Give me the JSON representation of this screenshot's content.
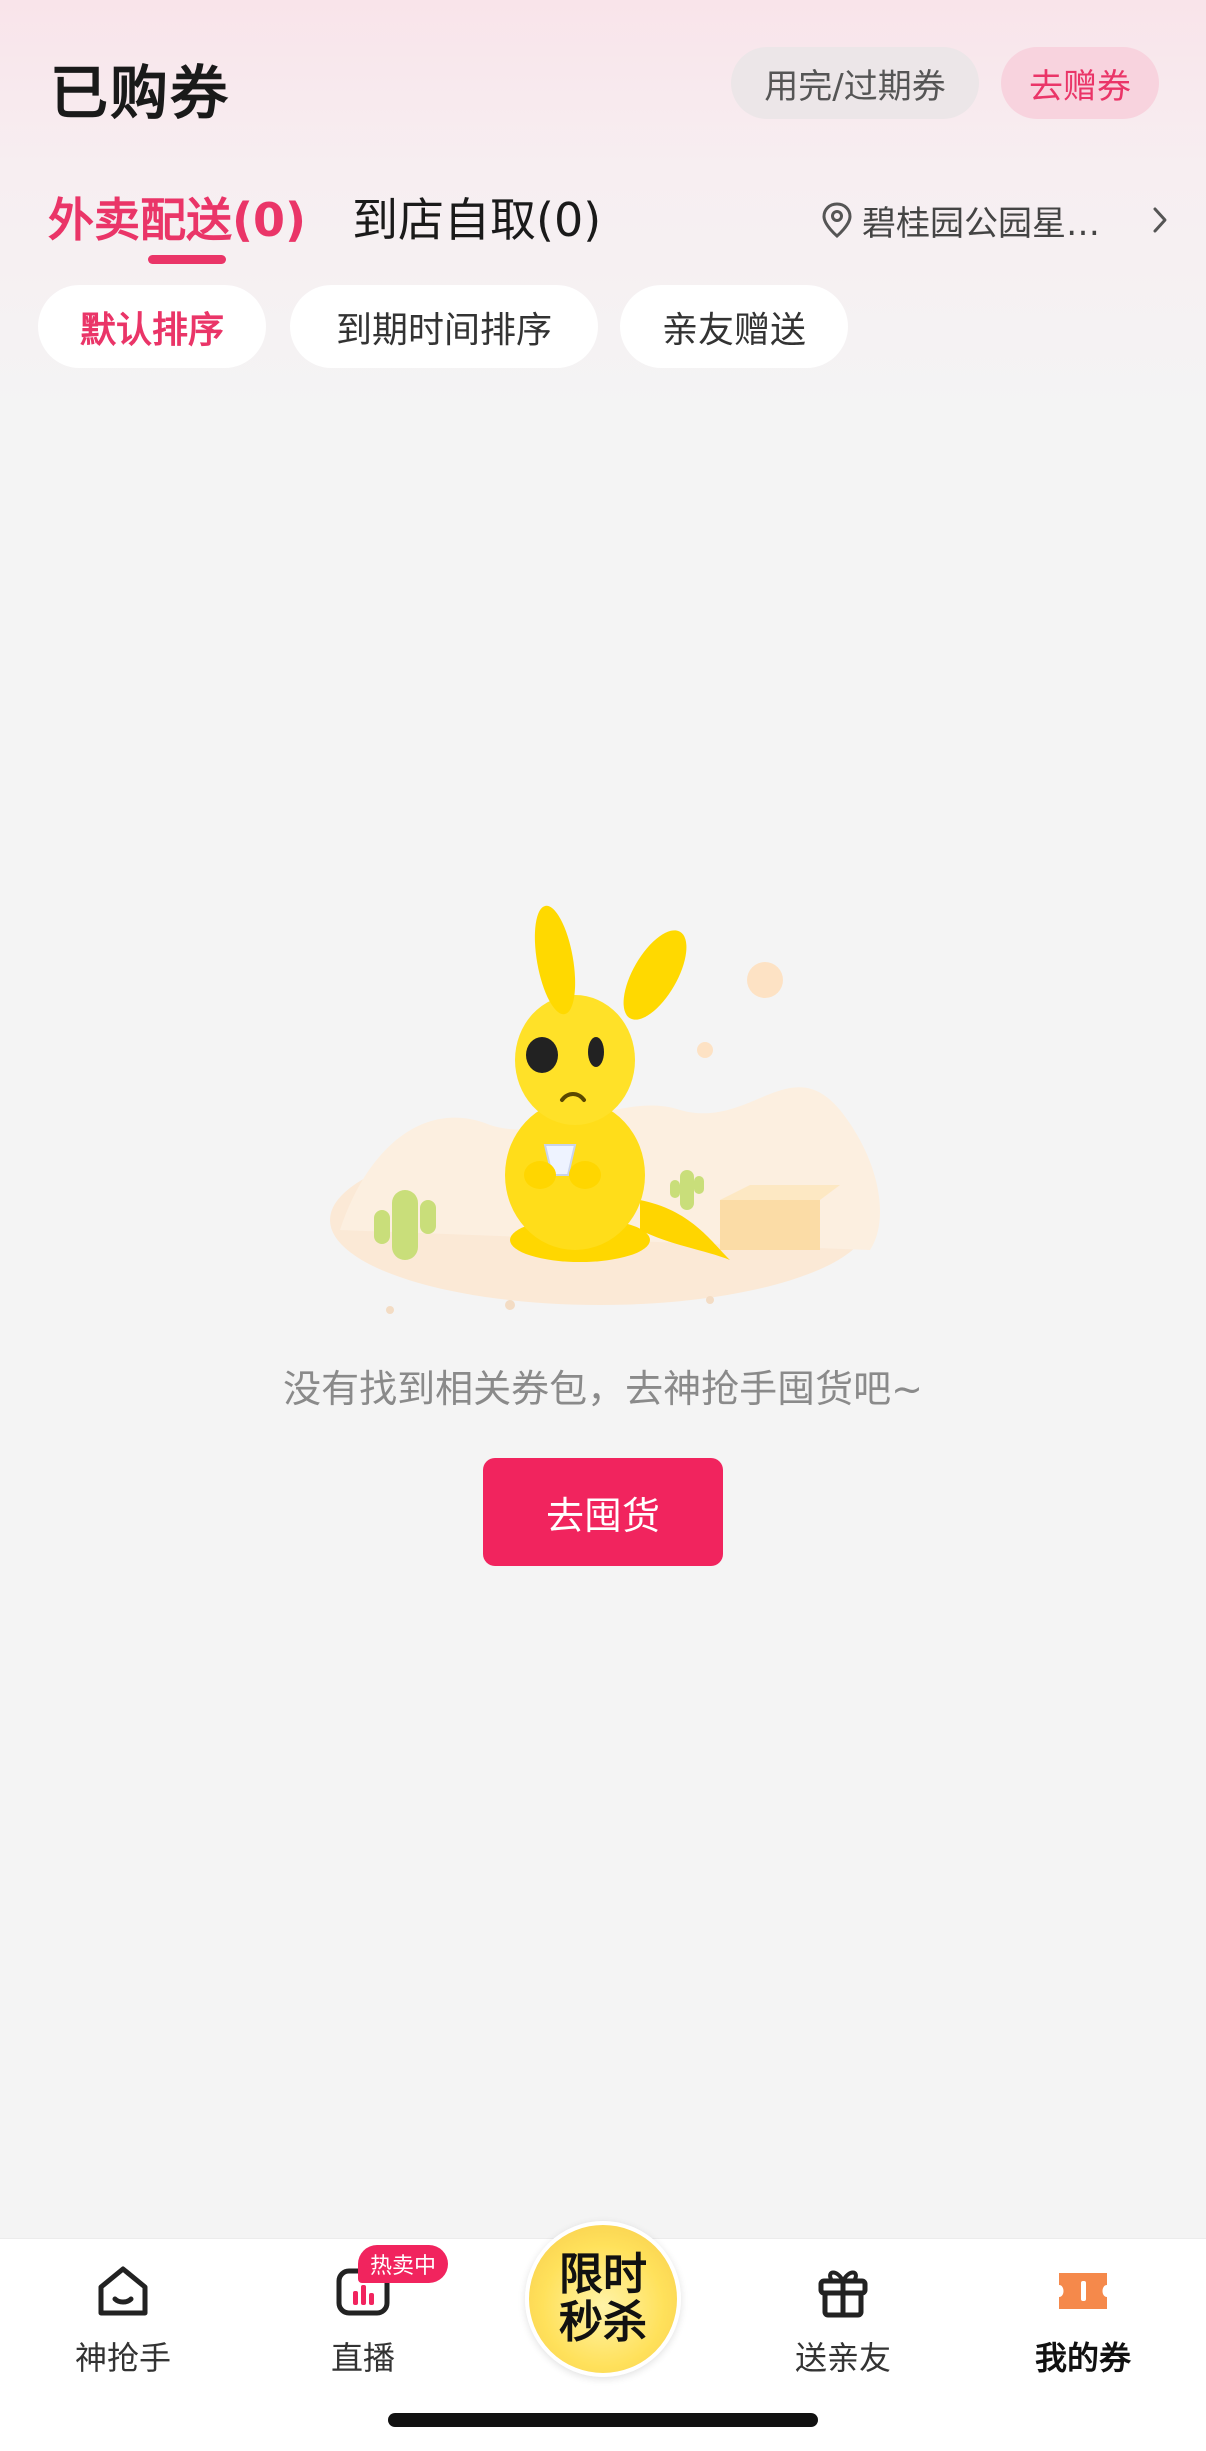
{
  "header": {
    "title": "已购券",
    "expired_label": "用完/过期券",
    "gift_label": "去赠券"
  },
  "tabs": [
    {
      "label": "外卖配送(0)",
      "active": true
    },
    {
      "label": "到店自取(0)",
      "active": false
    }
  ],
  "location": {
    "label": "碧桂园公园星…",
    "icon": "location-pin-icon"
  },
  "filters": [
    {
      "label": "默认排序",
      "active": true
    },
    {
      "label": "到期时间排序",
      "active": false
    },
    {
      "label": "亲友赠送",
      "active": false
    }
  ],
  "empty_state": {
    "message": "没有找到相关券包，去神抢手囤货吧~",
    "cta_label": "去囤货"
  },
  "tabbar": {
    "items": [
      {
        "label": "神抢手",
        "icon": "home-icon"
      },
      {
        "label": "直播",
        "icon": "live-icon",
        "badge": "热卖中"
      },
      {
        "label": "送亲友",
        "icon": "gift-icon"
      },
      {
        "label": "我的券",
        "icon": "coupon-icon",
        "active": true
      }
    ],
    "center": {
      "line1": "限时",
      "line2": "秒杀"
    }
  },
  "colors": {
    "accent": "#ea3568",
    "cta": "#f1245e",
    "background": "#f4f4f4"
  }
}
